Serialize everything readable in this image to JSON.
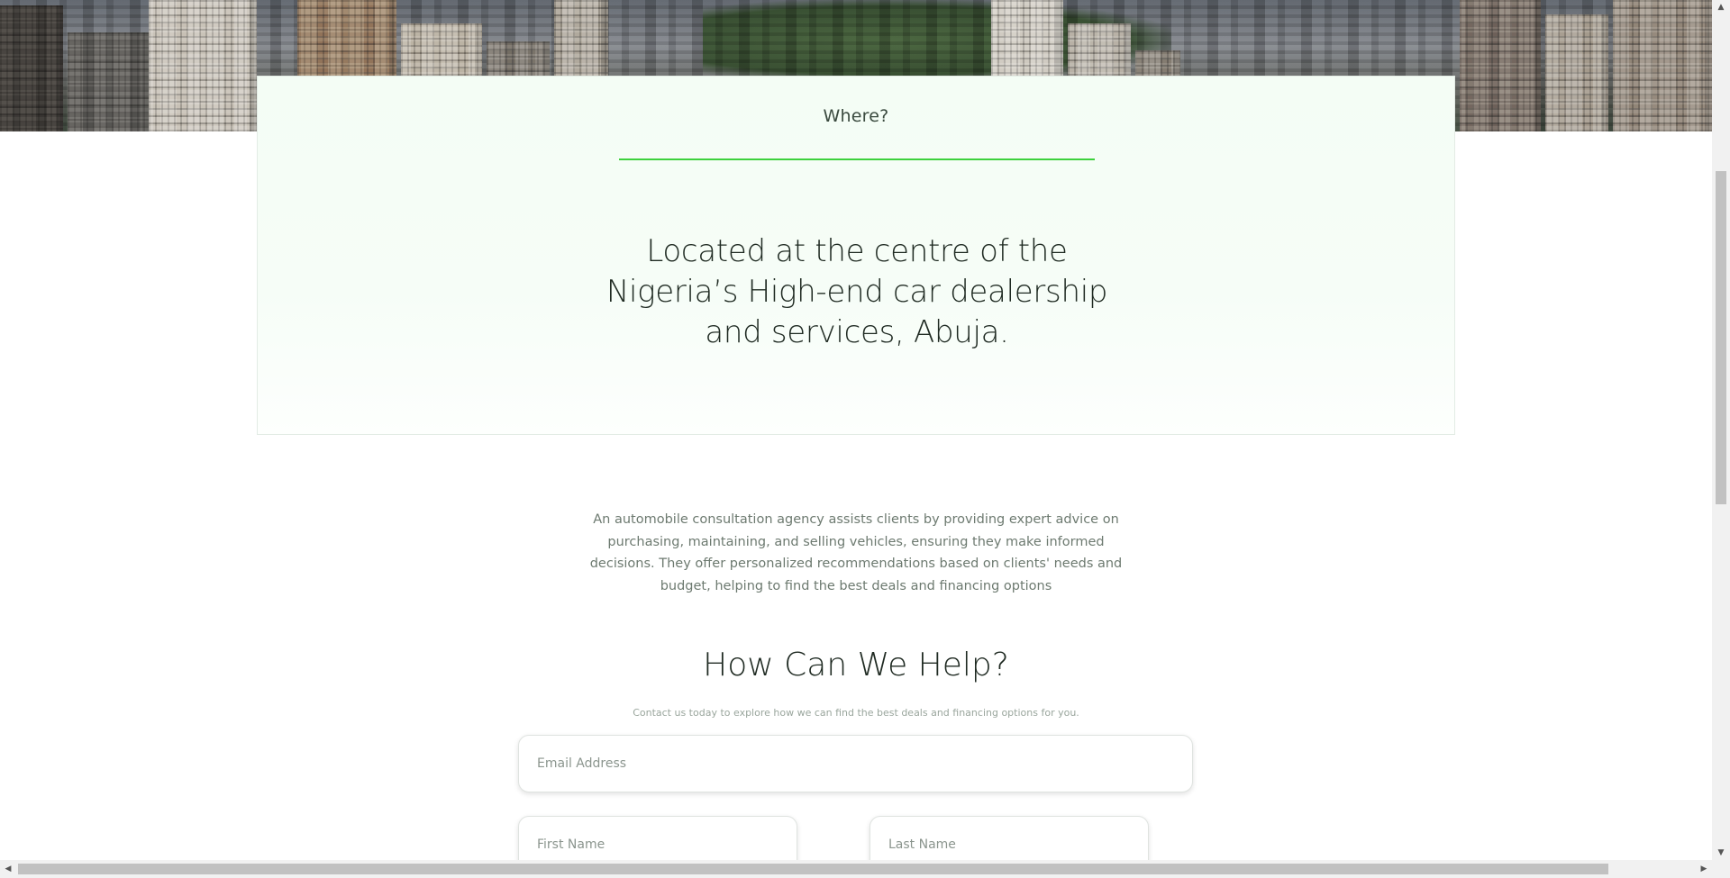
{
  "hero": {
    "image": "city-skyline-photo"
  },
  "location_card": {
    "eyebrow": "Where?",
    "accent_color": "#3dd13d",
    "headline_lines": [
      "Located at the centre of the",
      "Nigeria’s High-end car dealership",
      "and services, Abuja."
    ]
  },
  "about": {
    "description": "An automobile consultation agency assists clients by providing expert advice on purchasing, maintaining, and selling vehicles, ensuring they make informed decisions. They offer personalized recommendations based on clients' needs and budget, helping to find the best deals and financing options"
  },
  "contact": {
    "title": "How Can We Help?",
    "subtitle": "Contact us today to explore how we can find the best deals and financing options for you.",
    "email_placeholder": "Email Address",
    "first_name_placeholder": "First Name",
    "last_name_placeholder": "Last Name"
  },
  "scrollbars": {
    "up_arrow": "▲",
    "down_arrow": "▼",
    "left_arrow": "◀",
    "right_arrow": "▶"
  }
}
